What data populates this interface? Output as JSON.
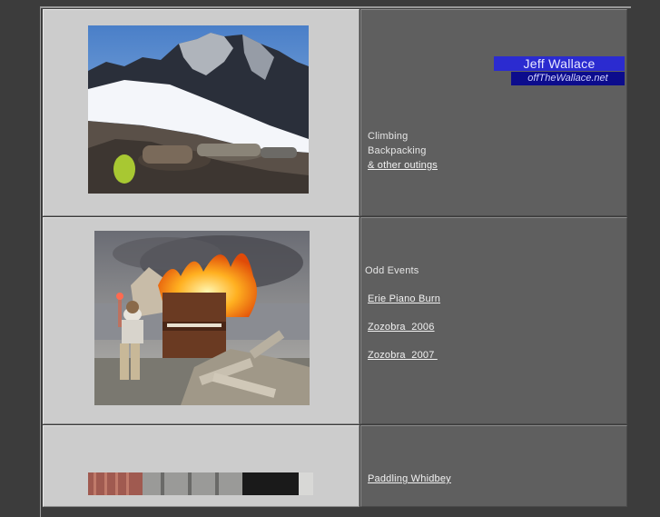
{
  "header": {
    "name": "Jeff Wallace",
    "site": "offTheWallace.net"
  },
  "row1": {
    "links": [
      "Climbing",
      "Backpacking",
      "& other outings"
    ]
  },
  "row2": {
    "heading": "Odd Events",
    "links": [
      "Erie Piano Burn",
      "Zozobra  2006",
      "Zozobra  2007 "
    ]
  },
  "row3": {
    "links": [
      "Paddling Whidbey"
    ]
  },
  "colors": {
    "page_bg": "#3c3c3c",
    "photo_cell_bg": "#cccccc",
    "text_cell_bg": "#5f5f5f",
    "brand_title_bg": "#2b2bd0",
    "brand_url_bg": "#0c0c8c"
  }
}
